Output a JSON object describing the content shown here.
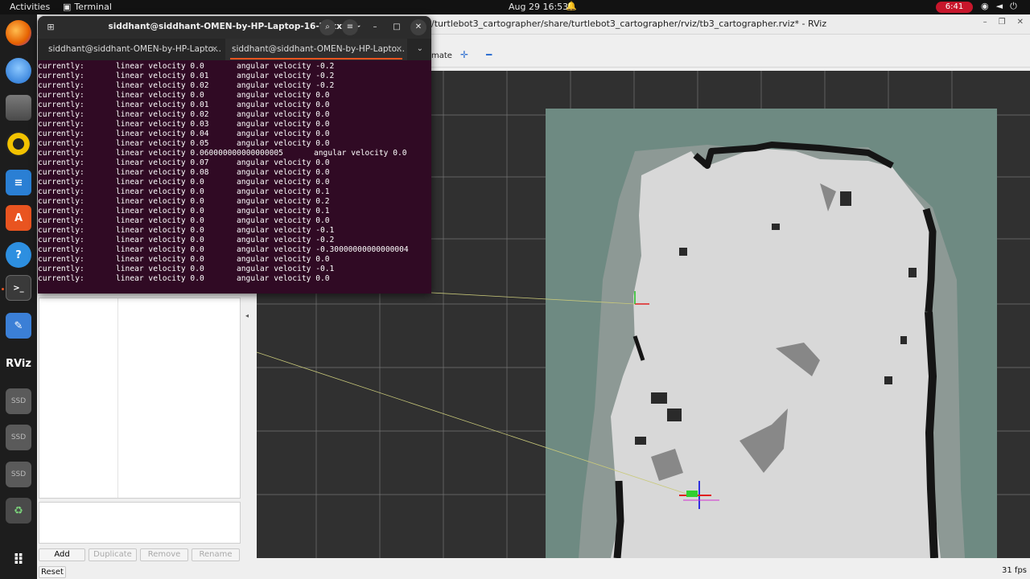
{
  "topbar": {
    "activities": "Activities",
    "app_name": "Terminal",
    "clock": "Aug 29  16:53",
    "battery": "6:41"
  },
  "dock": {
    "icons": [
      "firefox-icon",
      "thunderbird-icon",
      "files-icon",
      "rhythmbox-icon",
      "libreoffice-writer-icon",
      "app-center-icon",
      "help-icon",
      "terminal-icon",
      "text-editor-icon",
      "rviz-icon",
      "ssd-drive-icon",
      "ssd-drive-icon",
      "ssd-drive-icon",
      "trash-icon",
      "show-apps-icon"
    ],
    "rviz_label": "RViz",
    "ssd_label": "SSD"
  },
  "rviz": {
    "title": "/turtlebot3_cartographer/share/turtlebot3_cartographer/rviz/tb3_cartographer.rviz* - RViz",
    "toolbar_partial": "mate",
    "buttons": {
      "add": "Add",
      "duplicate": "Duplicate",
      "remove": "Remove",
      "rename": "Rename",
      "reset": "Reset"
    },
    "fps": "31 fps",
    "colors": {
      "grid": "#8a8a8a",
      "map_unknown": "#6e8a82",
      "map_free": "#d8d8d8",
      "map_occupied": "#151515"
    }
  },
  "terminal": {
    "header_title": "siddhant@siddhant-OMEN-by-HP-Laptop-16-b1xxx: ~",
    "tabs": [
      {
        "label": "siddhant@siddhant-OMEN-by-HP-Lapto...",
        "active": false
      },
      {
        "label": "siddhant@siddhant-OMEN-by-HP-Lapto...",
        "active": true
      }
    ],
    "lines": [
      {
        "a": "currently:",
        "b": "linear velocity 0.0",
        "c": "angular velocity -0.2"
      },
      {
        "a": "currently:",
        "b": "linear velocity 0.01",
        "c": "angular velocity -0.2"
      },
      {
        "a": "currently:",
        "b": "linear velocity 0.02",
        "c": "angular velocity -0.2"
      },
      {
        "a": "currently:",
        "b": "linear velocity 0.0",
        "c": "angular velocity 0.0"
      },
      {
        "a": "currently:",
        "b": "linear velocity 0.01",
        "c": "angular velocity 0.0"
      },
      {
        "a": "currently:",
        "b": "linear velocity 0.02",
        "c": "angular velocity 0.0"
      },
      {
        "a": "currently:",
        "b": "linear velocity 0.03",
        "c": "angular velocity 0.0"
      },
      {
        "a": "currently:",
        "b": "linear velocity 0.04",
        "c": "angular velocity 0.0"
      },
      {
        "a": "currently:",
        "b": "linear velocity 0.05",
        "c": "angular velocity 0.0"
      },
      {
        "a": "currently:",
        "b": "linear velocity 0.060000000000000005",
        "c": "angular velocity 0.0",
        "wide": true
      },
      {
        "a": "currently:",
        "b": "linear velocity 0.07",
        "c": "angular velocity 0.0"
      },
      {
        "a": "currently:",
        "b": "linear velocity 0.08",
        "c": "angular velocity 0.0"
      },
      {
        "a": "currently:",
        "b": "linear velocity 0.0",
        "c": "angular velocity 0.0"
      },
      {
        "a": "currently:",
        "b": "linear velocity 0.0",
        "c": "angular velocity 0.1"
      },
      {
        "a": "currently:",
        "b": "linear velocity 0.0",
        "c": "angular velocity 0.2"
      },
      {
        "a": "currently:",
        "b": "linear velocity 0.0",
        "c": "angular velocity 0.1"
      },
      {
        "a": "currently:",
        "b": "linear velocity 0.0",
        "c": "angular velocity 0.0"
      },
      {
        "a": "currently:",
        "b": "linear velocity 0.0",
        "c": "angular velocity -0.1"
      },
      {
        "a": "currently:",
        "b": "linear velocity 0.0",
        "c": "angular velocity -0.2"
      },
      {
        "a": "currently:",
        "b": "linear velocity 0.0",
        "c": "angular velocity -0.30000000000000004"
      },
      {
        "a": "currently:",
        "b": "linear velocity 0.0",
        "c": "angular velocity 0.0"
      },
      {
        "a": "currently:",
        "b": "linear velocity 0.0",
        "c": "angular velocity -0.1"
      },
      {
        "a": "currently:",
        "b": "linear velocity 0.0",
        "c": "angular velocity 0.0"
      }
    ]
  }
}
